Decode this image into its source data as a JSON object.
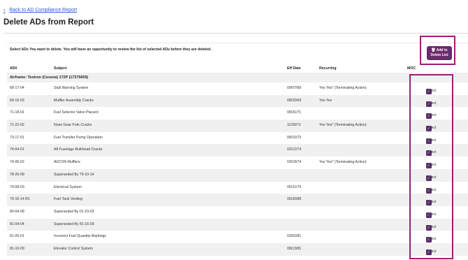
{
  "nav": {
    "back_label": "Back to AD Compliance Report"
  },
  "page": {
    "title": "Delete ADs from Report"
  },
  "instructions": "Select ADs You want to delete. You will have an opportunity to review the list of selected ADs before they are deleted.",
  "add_button": {
    "line1": "Add to",
    "line2": "Delete List"
  },
  "columns": {
    "ad": "AD#",
    "subject": "Subject",
    "eff_date": "Eff Date",
    "recurring": "Recurring",
    "moc": "MOC"
  },
  "group": {
    "label": "Airframe: Textron (Cessna) 172P (17275659)"
  },
  "select_label": "Select",
  "rows": [
    {
      "ad": "68-17-04",
      "subject": "Stall Warning System",
      "eff": "09/07/68",
      "rec": "Yes Yes* (Terminating Action)"
    },
    {
      "ad": "69-15-03",
      "subject": "Muffler Assembly Cracks",
      "eff": "08/20/69",
      "rec": "Yes Yes"
    },
    {
      "ad": "71-18-01",
      "subject": "Fuel Selector Valve Placard",
      "eff": "08/31/71",
      "rec": ""
    },
    {
      "ad": "71-22-02",
      "subject": "Nose Gear Fork Cracks",
      "eff": "11/09/71",
      "rec": "Yes Yes* (Terminating Action)"
    },
    {
      "ad": "73-17-01",
      "subject": "Fuel Transfer Pump Operation",
      "eff": "08/16/73",
      "rec": ""
    },
    {
      "ad": "74-04-01",
      "subject": "Aft Fuselage Bulkhead Cracks",
      "eff": "02/12/74",
      "rec": ""
    },
    {
      "ad": "74-06-02",
      "subject": "AVCON Mufflers",
      "eff": "03/18/74",
      "rec": "Yes Yes* (Terminating Action)"
    },
    {
      "ad": "78-26-09",
      "subject": "Superseded By 79-10-14",
      "eff": "",
      "rec": ""
    },
    {
      "ad": "79-08-03",
      "subject": "Electrical System",
      "eff": "05/21/79",
      "rec": ""
    },
    {
      "ad": "79-10-14 R1",
      "subject": "Fuel Tank Venting",
      "eff": "05/30/88",
      "rec": ""
    },
    {
      "ad": "80-04-08",
      "subject": "Superseded By 01-23-03",
      "eff": "",
      "rec": ""
    },
    {
      "ad": "81-04-04",
      "subject": "Superseded By 81-16-09",
      "eff": "",
      "rec": ""
    },
    {
      "ad": "81-05-01",
      "subject": "Incorrect Fuel Quantity Markings",
      "eff": "03/02/81",
      "rec": ""
    },
    {
      "ad": "81-16-09",
      "subject": "Elevator Control System",
      "eff": "08/13/81",
      "rec": ""
    }
  ]
}
